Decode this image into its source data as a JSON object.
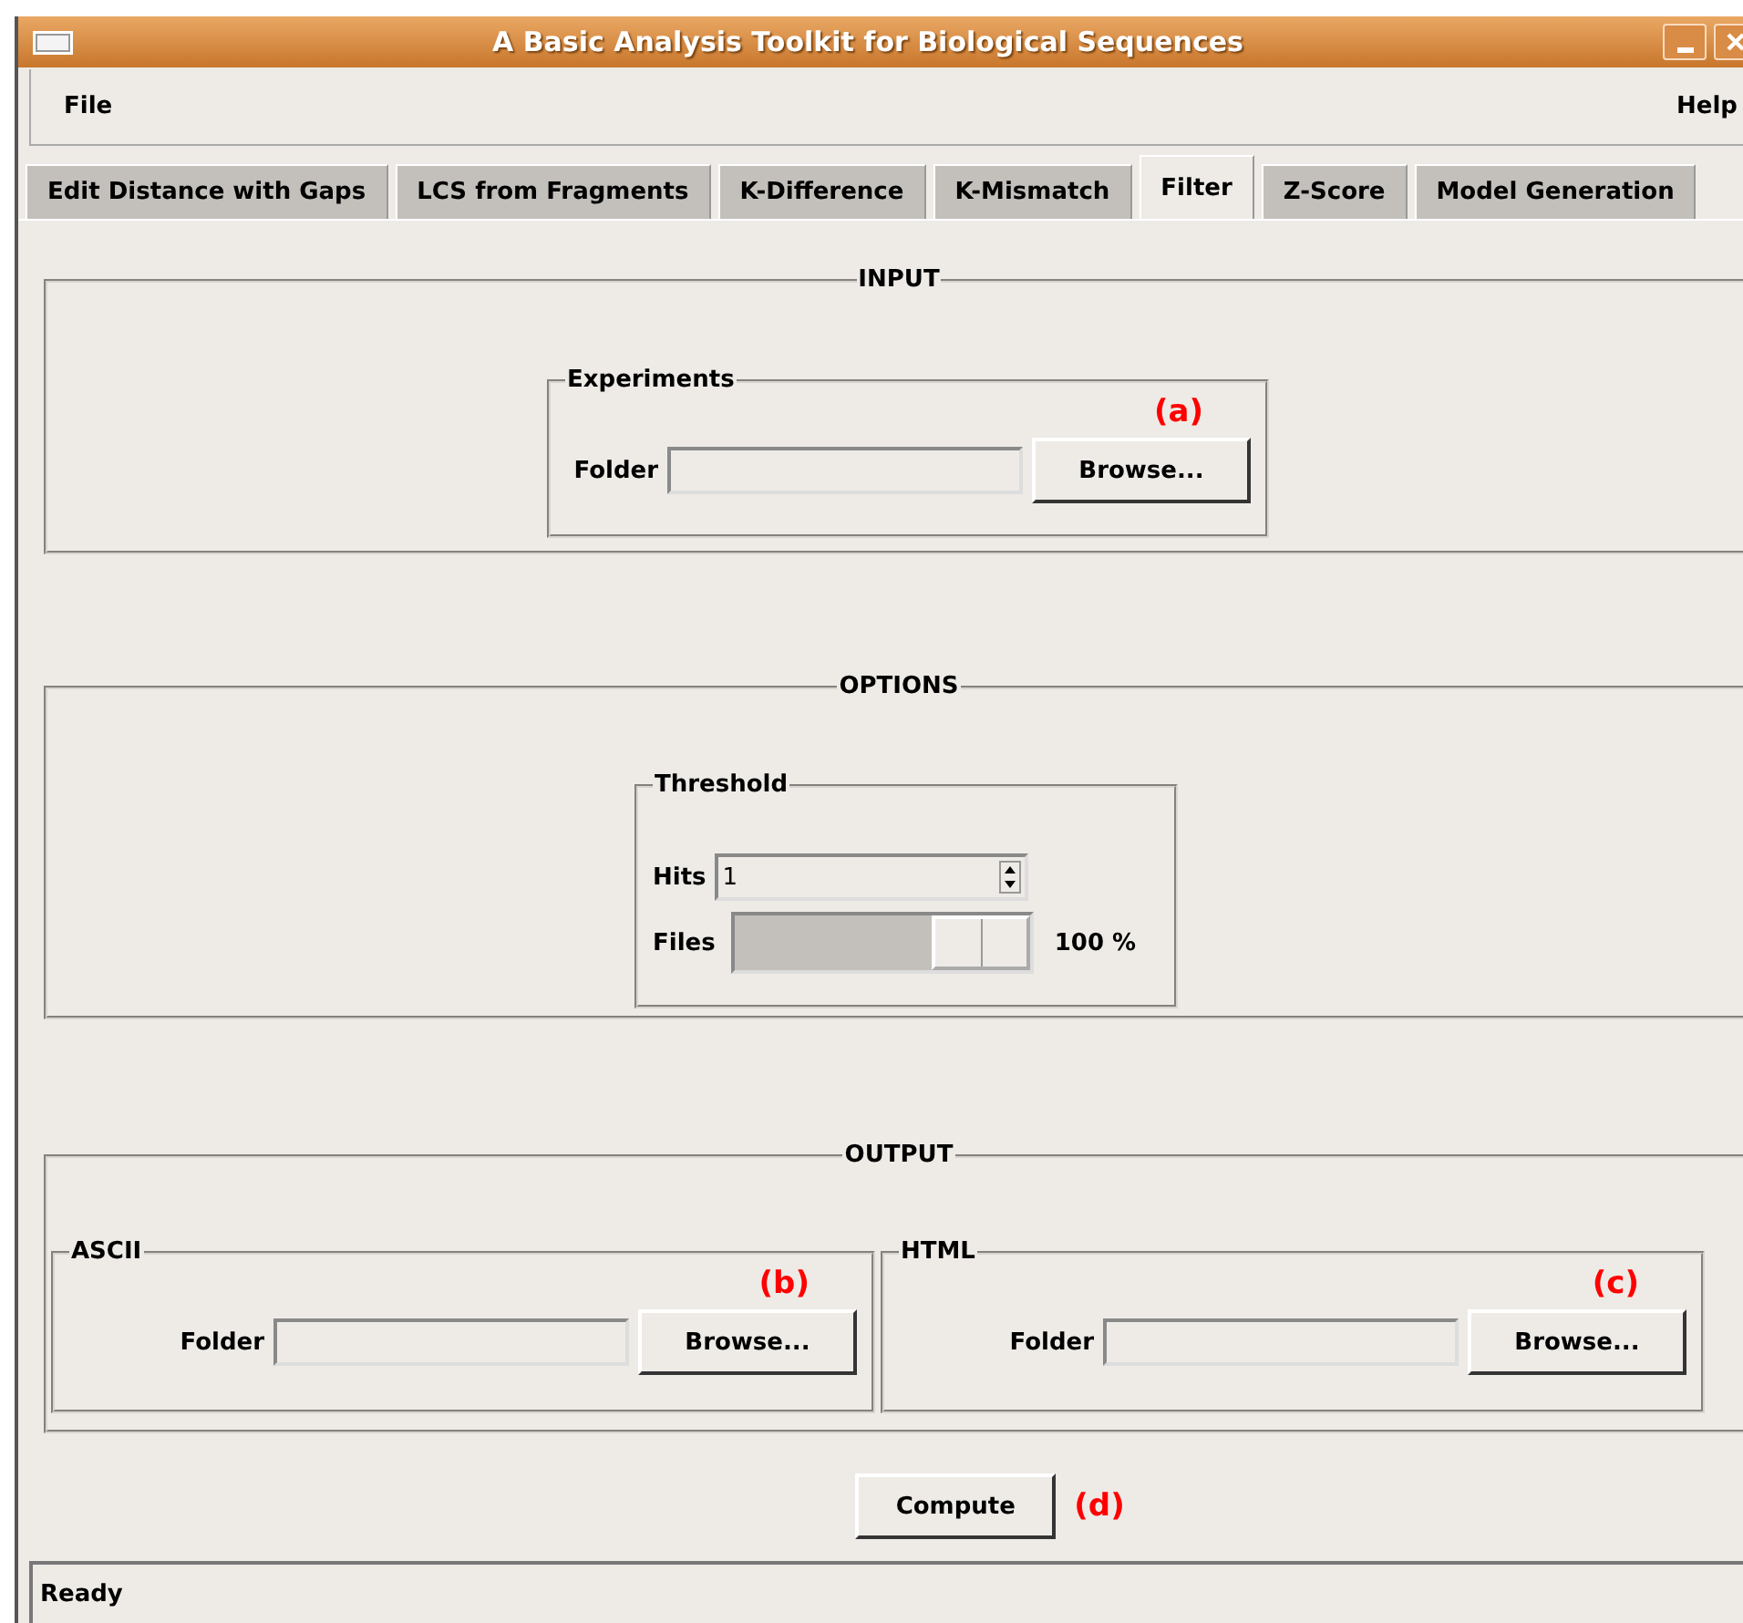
{
  "window": {
    "title": "A Basic Analysis Toolkit for Biological Sequences"
  },
  "menu": [
    {
      "label": "File"
    },
    {
      "label": "Help"
    }
  ],
  "tabs": [
    {
      "label": "Edit Distance with Gaps",
      "selected": false
    },
    {
      "label": "LCS from Fragments",
      "selected": false
    },
    {
      "label": "K-Difference",
      "selected": false
    },
    {
      "label": "K-Mismatch",
      "selected": false
    },
    {
      "label": "Filter",
      "selected": true
    },
    {
      "label": "Z-Score",
      "selected": false
    },
    {
      "label": "Model Generation",
      "selected": false
    }
  ],
  "input": {
    "title": "INPUT",
    "group": {
      "title": "Experiments",
      "annotation": "(a)",
      "field_label": "Folder",
      "button": "Browse..."
    }
  },
  "options": {
    "title": "OPTIONS",
    "group": {
      "title": "Threshold",
      "hits": {
        "label": "Hits",
        "value": "1"
      },
      "files": {
        "label": "Files",
        "level": 1,
        "reading": "100 %"
      }
    }
  },
  "output": {
    "title": "OUTPUT",
    "groups": [
      {
        "title": "ASCII",
        "annotation": "(b)",
        "field_label": "Folder",
        "button": "Browse..."
      },
      {
        "title": "HTML",
        "annotation": "(c)",
        "field_label": "Folder",
        "button": "Browse..."
      }
    ]
  },
  "compute": {
    "label": "Compute",
    "annotation": "(d)"
  },
  "status_bar": "Ready"
}
